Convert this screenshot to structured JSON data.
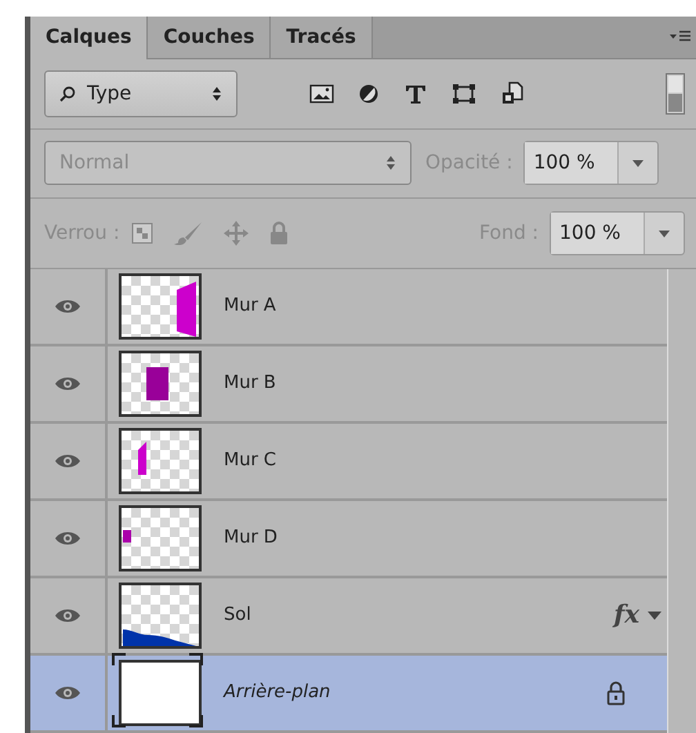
{
  "tabs": [
    {
      "label": "Calques",
      "selected": true
    },
    {
      "label": "Couches",
      "selected": false
    },
    {
      "label": "Tracés",
      "selected": false
    }
  ],
  "filter": {
    "value": "Type"
  },
  "blend_mode": {
    "value": "Normal",
    "disabled": true
  },
  "opacity": {
    "label": "Opacité :",
    "value": "100 %",
    "disabled": true
  },
  "lock": {
    "label": "Verrou :",
    "disabled": true
  },
  "fill": {
    "label": "Fond :",
    "value": "100 %",
    "disabled": true
  },
  "layers": [
    {
      "name": "Mur A",
      "kind": "layer",
      "visible": true,
      "selected": false,
      "locked": false,
      "effects": false
    },
    {
      "name": "Mur B",
      "kind": "layer",
      "visible": true,
      "selected": false,
      "locked": false,
      "effects": false
    },
    {
      "name": "Mur C",
      "kind": "layer",
      "visible": true,
      "selected": false,
      "locked": false,
      "effects": false
    },
    {
      "name": "Mur D",
      "kind": "layer",
      "visible": true,
      "selected": false,
      "locked": false,
      "effects": false
    },
    {
      "name": "Sol",
      "kind": "layer",
      "visible": true,
      "selected": false,
      "locked": false,
      "effects": true,
      "effects_label": "fx"
    },
    {
      "name": "Arrière-plan",
      "kind": "background",
      "visible": true,
      "selected": true,
      "locked": true,
      "effects": false
    }
  ]
}
